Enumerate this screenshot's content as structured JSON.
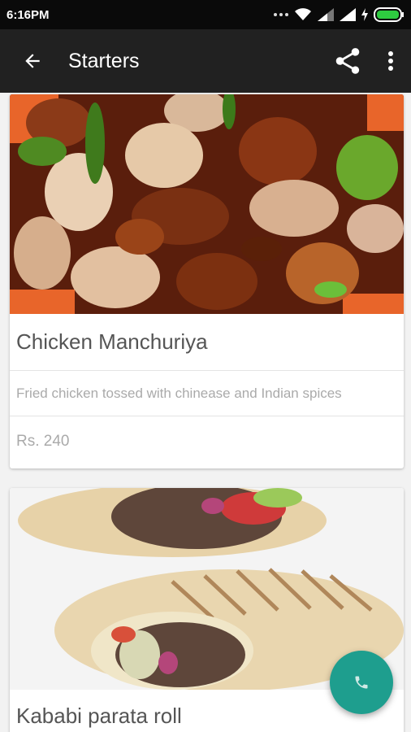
{
  "status_bar": {
    "time": "6:16PM"
  },
  "toolbar": {
    "title": "Starters"
  },
  "items": [
    {
      "name": "Chicken Manchuriya",
      "description": "Fried chicken tossed with chinease and Indian spices",
      "price": "Rs. 240"
    },
    {
      "name": "Kababi parata roll"
    }
  ],
  "icons": {
    "back": "arrow-back-icon",
    "share": "share-icon",
    "more": "more-vert-icon",
    "fab": "phone-icon"
  },
  "colors": {
    "toolbar": "#212121",
    "status_bar": "#0a0a0a",
    "fab": "#1e9e8e"
  }
}
